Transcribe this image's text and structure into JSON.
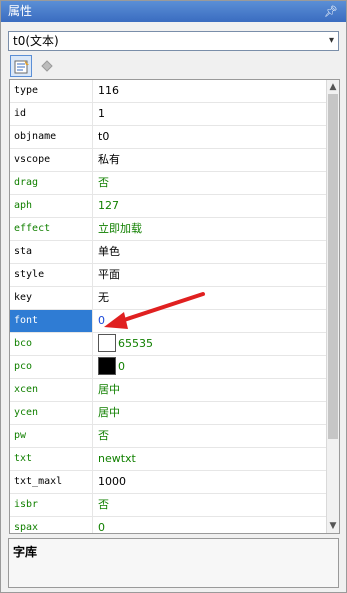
{
  "panel": {
    "title": "属性",
    "pin_icon": "pin-icon"
  },
  "object_select": {
    "selected": "t0(文本)"
  },
  "toolbar": {
    "buttons": [
      {
        "name": "properties-view",
        "icon": "properties-icon"
      },
      {
        "name": "events-view",
        "icon": "diamond-icon"
      }
    ]
  },
  "properties": [
    {
      "name": "type",
      "value": "116",
      "color": "black"
    },
    {
      "name": "id",
      "value": "1",
      "color": "black"
    },
    {
      "name": "objname",
      "value": "t0",
      "color": "black"
    },
    {
      "name": "vscope",
      "value": "私有",
      "color": "black"
    },
    {
      "name": "drag",
      "value": "否",
      "color": "green"
    },
    {
      "name": "aph",
      "value": "127",
      "color": "green"
    },
    {
      "name": "effect",
      "value": "立即加载",
      "color": "green"
    },
    {
      "name": "sta",
      "value": "单色",
      "color": "black"
    },
    {
      "name": "style",
      "value": "平面",
      "color": "black"
    },
    {
      "name": "key",
      "value": "无",
      "color": "black"
    },
    {
      "name": "font",
      "value": "0",
      "color": "green",
      "selected": true
    },
    {
      "name": "bco",
      "value": "65535",
      "color": "green",
      "swatch": "#ffffff"
    },
    {
      "name": "pco",
      "value": "0",
      "color": "green",
      "swatch": "#000000"
    },
    {
      "name": "xcen",
      "value": "居中",
      "color": "green"
    },
    {
      "name": "ycen",
      "value": "居中",
      "color": "green"
    },
    {
      "name": "pw",
      "value": "否",
      "color": "green"
    },
    {
      "name": "txt",
      "value": "newtxt",
      "color": "green"
    },
    {
      "name": "txt_maxl",
      "value": "1000",
      "color": "black"
    },
    {
      "name": "isbr",
      "value": "否",
      "color": "green"
    },
    {
      "name": "spax",
      "value": "0",
      "color": "green"
    }
  ],
  "description": {
    "label": "字库"
  },
  "annotation": {
    "arrow_color": "#e02020"
  }
}
